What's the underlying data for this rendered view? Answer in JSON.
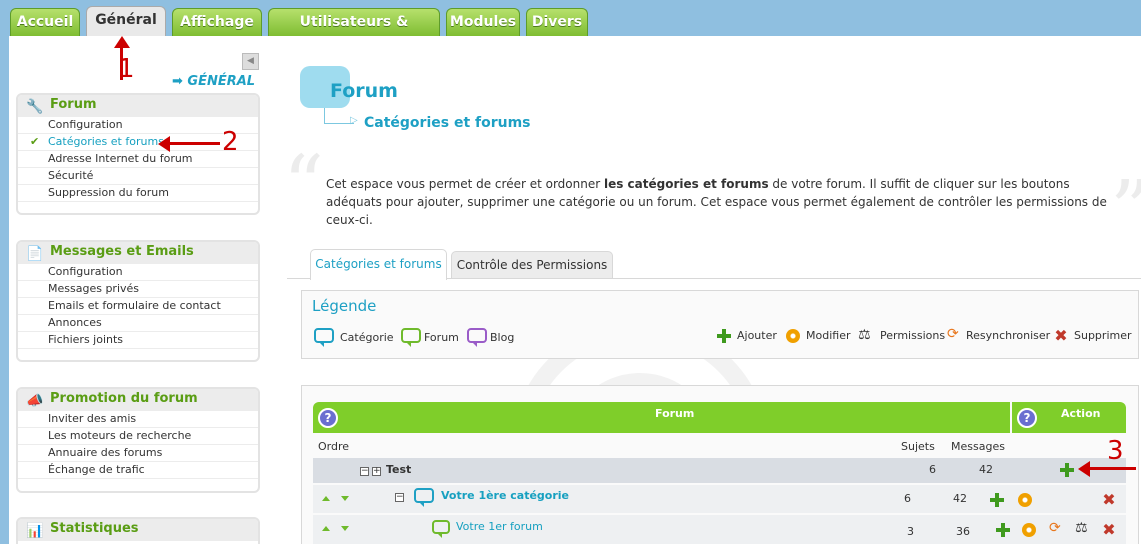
{
  "tabs": [
    "Accueil",
    "Général",
    "Affichage",
    "Utilisateurs & Groupes",
    "Modules",
    "Divers"
  ],
  "section_link": "GÉNÉRAL",
  "sidebar": [
    {
      "title": "Forum",
      "icon": "wrench-icon",
      "items": [
        "Configuration",
        "Catégories et forums",
        "Adresse Internet du forum",
        "Sécurité",
        "Suppression du forum"
      ]
    },
    {
      "title": "Messages et Emails",
      "icon": "document-icon",
      "items": [
        "Configuration",
        "Messages privés",
        "Emails et formulaire de contact",
        "Annonces",
        "Fichiers joints"
      ]
    },
    {
      "title": "Promotion du forum",
      "icon": "megaphone-icon",
      "items": [
        "Inviter des amis",
        "Les moteurs de recherche",
        "Annuaire des forums",
        "Échange de trafic"
      ]
    },
    {
      "title": "Statistiques",
      "icon": "chart-icon",
      "items": []
    }
  ],
  "page": {
    "title": "Forum",
    "subtitle": "Catégories et forums",
    "desc_pre": "Cet espace vous permet de créer et ordonner ",
    "desc_bold": "les catégories et forums",
    "desc_post": " de votre forum. Il suffit de cliquer sur les boutons adéquats pour ajouter, supprimer une catégorie ou un forum. Cet espace vous permet également de contrôler les permissions de ceux-ci."
  },
  "subtabs": [
    "Catégories et forums",
    "Contrôle des Permissions"
  ],
  "legend": {
    "title": "Légende",
    "types": [
      "Catégorie",
      "Forum",
      "Blog"
    ],
    "actions": [
      "Ajouter",
      "Modifier",
      "Permissions",
      "Resynchroniser",
      "Supprimer"
    ]
  },
  "table": {
    "header_forum": "Forum",
    "header_action": "Action",
    "col_order": "Ordre",
    "col_topics": "Sujets",
    "col_messages": "Messages",
    "rows": [
      {
        "name": "Test",
        "topics": "6",
        "messages": "42"
      },
      {
        "name": "Votre 1ère catégorie",
        "topics": "6",
        "messages": "42"
      },
      {
        "name": "Votre 1er forum",
        "topics": "3",
        "messages": "36"
      }
    ]
  },
  "annotations": [
    "1",
    "2",
    "3"
  ]
}
